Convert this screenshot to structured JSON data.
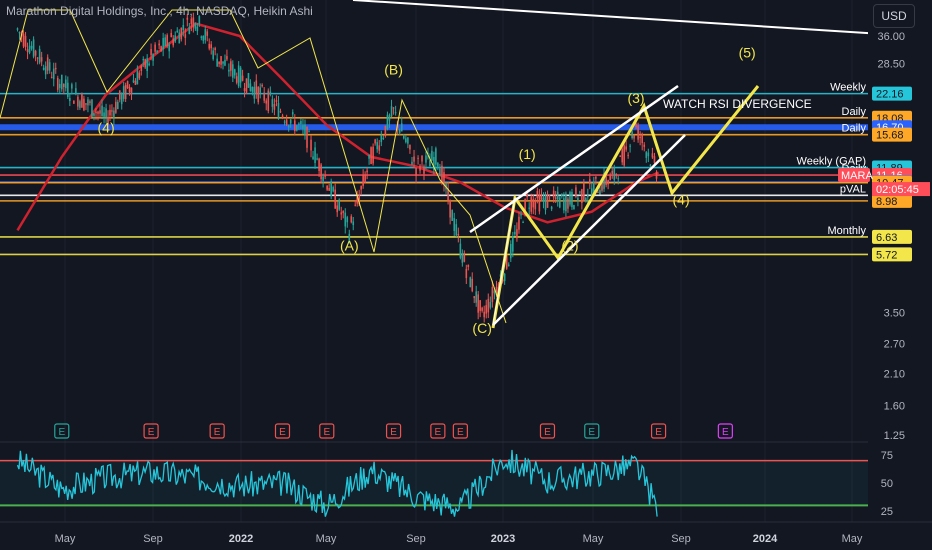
{
  "header": {
    "title": "Marathon Digital Holdings, Inc., 4h, NASDAQ, Heikin Ashi",
    "currency": "USD"
  },
  "colors": {
    "background": "#131722",
    "grid": "#1e222d",
    "axis_text": "#b2b5be",
    "wave": "#f2e64b",
    "channel": "#ffffff",
    "ma": "#d0222e",
    "cyan_level": "#26c6da",
    "orange_level": "#ffa726",
    "blue_level": "#2962ff",
    "rsi": "#26c6da"
  },
  "chart_data": [
    {
      "type": "candlestick",
      "title": "Marathon Digital Holdings, Inc., 4h, NASDAQ, Heikin Ashi",
      "y_scale": "log",
      "ylim": [
        1.1,
        50
      ],
      "y_ticks": [
        "36.00",
        "28.50",
        "3.50",
        "2.70",
        "2.10",
        "1.60",
        "1.25"
      ],
      "x_ticks": [
        "May",
        "Sep",
        "2022",
        "May",
        "Sep",
        "2023",
        "May",
        "Sep",
        "2024",
        "May"
      ],
      "price_path": [
        [
          "2021-03",
          38
        ],
        [
          "2021-05",
          24
        ],
        [
          "2021-07",
          18
        ],
        [
          "2021-09",
          30
        ],
        [
          "2021-11",
          42
        ],
        [
          "2021-12",
          30
        ],
        [
          "2022-02",
          22
        ],
        [
          "2022-04",
          16
        ],
        [
          "2022-06",
          7
        ],
        [
          "2022-07",
          13
        ],
        [
          "2022-08",
          19
        ],
        [
          "2022-09",
          12
        ],
        [
          "2022-10",
          13
        ],
        [
          "2022-11",
          6
        ],
        [
          "2022-12",
          3.4
        ],
        [
          "2023-01",
          5
        ],
        [
          "2023-02",
          9
        ],
        [
          "2023-04",
          9
        ],
        [
          "2023-05",
          10
        ],
        [
          "2023-06",
          11
        ],
        [
          "2023-07",
          16.7
        ],
        [
          "2023-08",
          11.2
        ]
      ],
      "moving_average": [
        [
          "2021-03",
          7
        ],
        [
          "2021-05",
          13
        ],
        [
          "2021-07",
          22
        ],
        [
          "2021-09",
          30
        ],
        [
          "2021-11",
          40
        ],
        [
          "2022-01",
          36
        ],
        [
          "2022-03",
          25
        ],
        [
          "2022-05",
          17
        ],
        [
          "2022-07",
          13
        ],
        [
          "2022-09",
          12
        ],
        [
          "2022-11",
          10.5
        ],
        [
          "2023-01",
          8.5
        ],
        [
          "2023-03",
          7.5
        ],
        [
          "2023-05",
          8.2
        ],
        [
          "2023-07",
          10.5
        ],
        [
          "2023-08",
          11.4
        ]
      ],
      "levels": [
        {
          "value": 22.16,
          "label": "Weekly",
          "tag": "22.16",
          "color": "#26c6da"
        },
        {
          "value": 18.08,
          "label": "Daily",
          "tag": "18.08",
          "color": "#ffa726"
        },
        {
          "value": 16.7,
          "label": "",
          "tag": "16.70",
          "color": "#2962ff"
        },
        {
          "value": 15.68,
          "label": "Daily",
          "tag": "15.68",
          "color": "#ffa726"
        },
        {
          "value": 11.89,
          "label": "Weekly (GAP)",
          "tag": "11.89",
          "color": "#26c6da"
        },
        {
          "value": 11.16,
          "label": "Daily",
          "tag": "11.16",
          "color": "#ff4e59"
        },
        {
          "value": 10.52,
          "label": "Daily",
          "tag": "10.52",
          "color": "#2962ff"
        },
        {
          "value": 10.47,
          "label": "",
          "tag": "10.47",
          "color": "#ffa726"
        },
        {
          "value": 9.41,
          "label": "pVAL",
          "tag": "9.41",
          "color": "#ffffff"
        },
        {
          "value": 8.98,
          "label": "",
          "tag": "8.98",
          "color": "#ffa726"
        },
        {
          "value": 6.63,
          "label": "Monthly",
          "tag": "6.63",
          "color": "#f2e64b"
        },
        {
          "value": 5.72,
          "label": "",
          "tag": "5.72",
          "color": "#f2e64b"
        }
      ],
      "current_price": {
        "symbol": "MARA",
        "price": "11.16",
        "countdown": "02:05:45"
      },
      "annotations": [
        {
          "text": "(4)",
          "date": "2021-07",
          "value": 16
        },
        {
          "text": "(B)",
          "date": "2022-08",
          "value": 26
        },
        {
          "text": "(A)",
          "date": "2022-06",
          "value": 5.9
        },
        {
          "text": "(1)",
          "date": "2023-02",
          "value": 12.8
        },
        {
          "text": "(C)",
          "date": "2022-12",
          "value": 2.95
        },
        {
          "text": "(2)",
          "date": "2023-04",
          "value": 5.9
        },
        {
          "text": "(3)",
          "date": "2023-07",
          "value": 20.5
        },
        {
          "text": "(4)",
          "date": "2023-09",
          "value": 8.7
        },
        {
          "text": "(5)",
          "date": "2023-12",
          "value": 30
        },
        {
          "text": "WATCH RSI DIVERGENCE",
          "date": "2023-08",
          "value": 20
        }
      ]
    },
    {
      "type": "line",
      "title": "",
      "ylim": [
        18,
        82
      ],
      "y_ticks": [
        "75",
        "50",
        "25"
      ],
      "bands": [
        30,
        70
      ],
      "rsi": [
        [
          "2021-03",
          70
        ],
        [
          "2021-05",
          45
        ],
        [
          "2021-07",
          55
        ],
        [
          "2021-09",
          60
        ],
        [
          "2021-11",
          55
        ],
        [
          "2022-01",
          48
        ],
        [
          "2022-03",
          50
        ],
        [
          "2022-05",
          30
        ],
        [
          "2022-07",
          62
        ],
        [
          "2022-09",
          38
        ],
        [
          "2022-11",
          28
        ],
        [
          "2023-01",
          72
        ],
        [
          "2023-03",
          52
        ],
        [
          "2023-05",
          58
        ],
        [
          "2023-07",
          66
        ],
        [
          "2023-08",
          26
        ]
      ],
      "earnings_markers": [
        {
          "date": "2021-05",
          "label": "E",
          "color": "#26a69a"
        },
        {
          "date": "2021-09",
          "label": "E",
          "color": "#ef5350"
        },
        {
          "date": "2021-12",
          "label": "E",
          "color": "#ef5350"
        },
        {
          "date": "2022-03",
          "label": "E",
          "color": "#ef5350"
        },
        {
          "date": "2022-05",
          "label": "E",
          "color": "#ef5350"
        },
        {
          "date": "2022-08",
          "label": "E",
          "color": "#ef5350"
        },
        {
          "date": "2022-10",
          "label": "E",
          "color": "#ef5350"
        },
        {
          "date": "2022-11",
          "label": "E",
          "color": "#ef5350"
        },
        {
          "date": "2023-03",
          "label": "E",
          "color": "#ef5350"
        },
        {
          "date": "2023-05",
          "label": "E",
          "color": "#26a69a"
        },
        {
          "date": "2023-08",
          "label": "E",
          "color": "#ef5350"
        },
        {
          "date": "2023-11",
          "label": "E",
          "color": "#e040fb"
        }
      ]
    }
  ]
}
